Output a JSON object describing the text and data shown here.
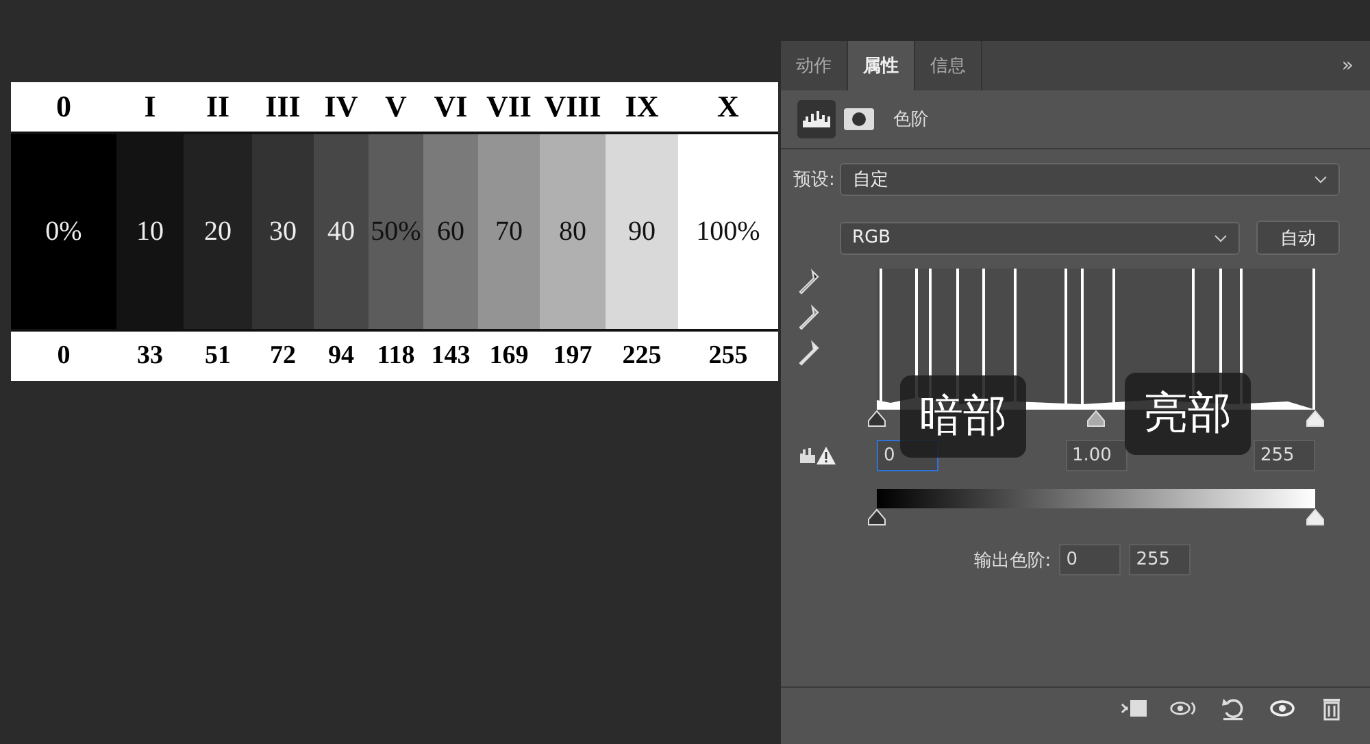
{
  "swatch_chart": {
    "columns": [
      {
        "numeral": "0",
        "percent": "0%",
        "value": "0",
        "color": "#000000"
      },
      {
        "numeral": "I",
        "percent": "10",
        "value": "33",
        "color": "#131313"
      },
      {
        "numeral": "II",
        "percent": "20",
        "value": "51",
        "color": "#222222"
      },
      {
        "numeral": "III",
        "percent": "30",
        "value": "72",
        "color": "#333333"
      },
      {
        "numeral": "IV",
        "percent": "40",
        "value": "94",
        "color": "#474747"
      },
      {
        "numeral": "V",
        "percent": "50%",
        "value": "118",
        "color": "#5c5c5c"
      },
      {
        "numeral": "VI",
        "percent": "60",
        "value": "143",
        "color": "#7a7a7a"
      },
      {
        "numeral": "VII",
        "percent": "70",
        "value": "169",
        "color": "#949494"
      },
      {
        "numeral": "VIII",
        "percent": "80",
        "value": "197",
        "color": "#b0b0b0"
      },
      {
        "numeral": "IX",
        "percent": "90",
        "value": "225",
        "color": "#d9d9d9"
      },
      {
        "numeral": "X",
        "percent": "100%",
        "value": "255",
        "color": "#ffffff"
      }
    ]
  },
  "panel": {
    "tabs": [
      {
        "label": "动作",
        "selected": false
      },
      {
        "label": "属性",
        "selected": true
      },
      {
        "label": "信息",
        "selected": false
      }
    ],
    "overflow": "»",
    "adjustment_title": "色阶",
    "preset_label": "预设:",
    "preset_value": "自定",
    "channel_value": "RGB",
    "auto_button": "自动",
    "input_thumbs": [
      {
        "kind": "shadow"
      },
      {
        "kind": "gamma"
      },
      {
        "kind": "highlight"
      }
    ],
    "input_fields": [
      {
        "value": "0",
        "focused": true
      },
      {
        "value": "1.00",
        "focused": false
      },
      {
        "value": "255",
        "focused": false
      }
    ],
    "output_thumbs": [
      {
        "kind": "shadow"
      },
      {
        "kind": "highlight"
      }
    ],
    "output_label": "输出色阶:",
    "output_fields": [
      "0",
      "255"
    ]
  },
  "overlay_labels": [
    "暗部",
    "亮部"
  ]
}
